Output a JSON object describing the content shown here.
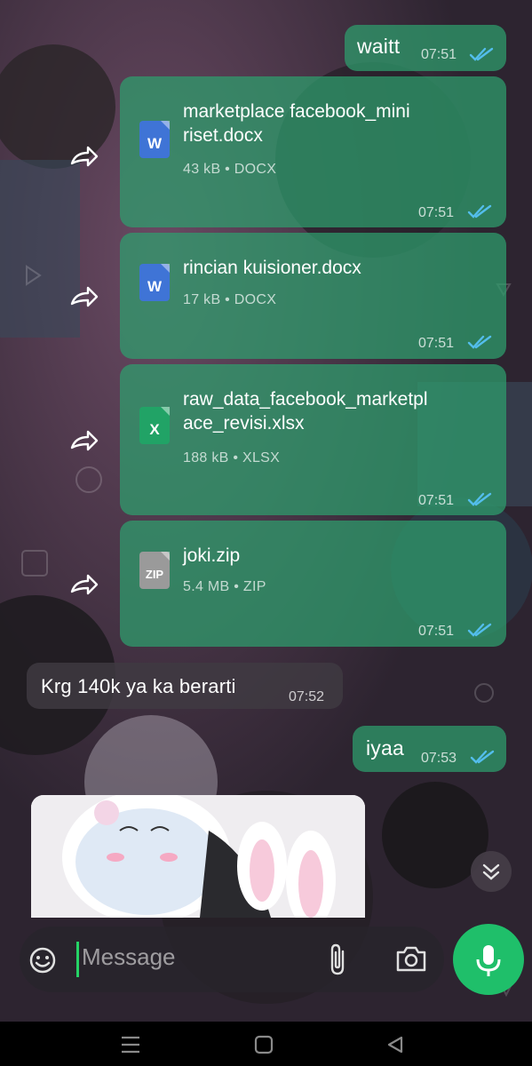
{
  "chat": {
    "messages": [
      {
        "type": "outgoing",
        "text": "waitt",
        "time": "07:51",
        "status": "read"
      },
      {
        "type": "outgoing-file",
        "forwarded": true,
        "file_icon": "word-doc-icon",
        "icon_letter": "W",
        "name_lines": [
          "marketplace facebook_mini",
          "riset.docx"
        ],
        "meta": "43 kB • DOCX",
        "time": "07:51",
        "status": "read"
      },
      {
        "type": "outgoing-file",
        "forwarded": true,
        "file_icon": "word-doc-icon",
        "icon_letter": "W",
        "name_lines": [
          "rincian kuisioner.docx"
        ],
        "meta": "17 kB • DOCX",
        "time": "07:51",
        "status": "read"
      },
      {
        "type": "outgoing-file",
        "forwarded": true,
        "file_icon": "excel-sheet-icon",
        "icon_letter": "X",
        "name_lines": [
          "raw_data_facebook_marketpl",
          "ace_revisi.xlsx"
        ],
        "meta": "188 kB • XLSX",
        "time": "07:51",
        "status": "read"
      },
      {
        "type": "outgoing-file",
        "forwarded": true,
        "file_icon": "zip-archive-icon",
        "icon_letter": "ZIP",
        "name_lines": [
          "joki.zip"
        ],
        "meta": "5.4 MB • ZIP",
        "time": "07:51",
        "status": "read"
      },
      {
        "type": "incoming",
        "text": "Krg 140k ya ka berarti",
        "time": "07:52"
      },
      {
        "type": "outgoing",
        "text": "iyaa",
        "time": "07:53",
        "status": "read"
      }
    ]
  },
  "composer": {
    "placeholder": "Message",
    "emoji_icon": "emoji-icon",
    "attach_icon": "paperclip-icon",
    "camera_icon": "camera-icon",
    "mic_icon": "microphone-icon"
  },
  "colors": {
    "outgoing_bubble": "#2ea06e",
    "tick_read": "#53bdeb",
    "mic_button": "#1fbf6a",
    "caret": "#25d366",
    "word": "#3f74d6",
    "excel": "#21a366",
    "zip": "#9a9a9a"
  },
  "navigation": {
    "recents_icon": "recents-icon",
    "home_icon": "home-icon",
    "back_icon": "back-icon"
  }
}
